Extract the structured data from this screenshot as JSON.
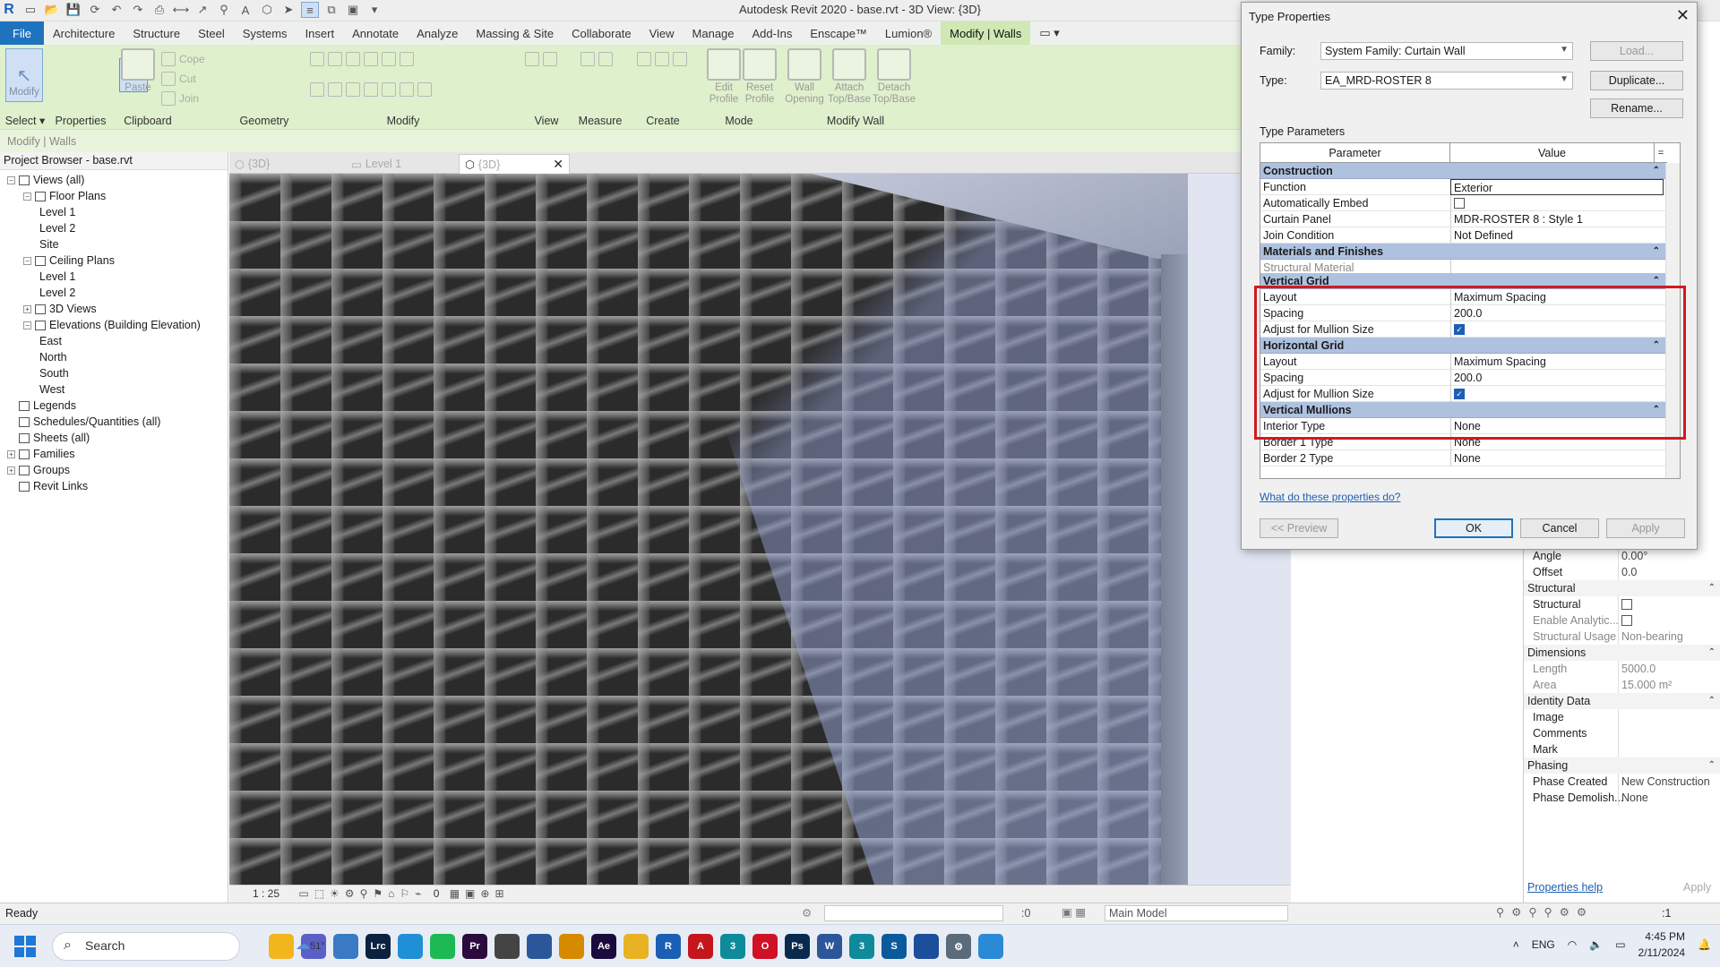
{
  "window": {
    "title": "Autodesk Revit 2020 - base.rvt - 3D View: {3D}"
  },
  "ribbon": {
    "tabs": [
      "File",
      "Architecture",
      "Structure",
      "Steel",
      "Systems",
      "Insert",
      "Annotate",
      "Analyze",
      "Massing & Site",
      "Collaborate",
      "View",
      "Manage",
      "Add-Ins",
      "Enscape™",
      "Lumion®",
      "Modify | Walls"
    ],
    "buttons": {
      "modify": "Modify",
      "paste": "Paste",
      "cope": "Cope",
      "cut": "Cut",
      "join": "Join",
      "edit_profile": "Edit Profile",
      "reset_profile": "Reset Profile",
      "wall_opening": "Wall Opening",
      "attach": "Attach Top/Base",
      "detach": "Detach Top/Base"
    },
    "groups": {
      "select": "Select",
      "properties": "Properties",
      "clipboard": "Clipboard",
      "geometry": "Geometry",
      "modify": "Modify",
      "view": "View",
      "measure": "Measure",
      "create": "Create",
      "mode": "Mode",
      "modify_wall": "Modify Wall"
    }
  },
  "option_bar": {
    "text": "Modify | Walls"
  },
  "project_browser": {
    "title": "Project Browser - base.rvt",
    "items": [
      {
        "label": "Views (all)",
        "level": 0,
        "tog": "−"
      },
      {
        "label": "Floor Plans",
        "level": 1,
        "tog": "−"
      },
      {
        "label": "Level 1",
        "level": 2
      },
      {
        "label": "Level 2",
        "level": 2
      },
      {
        "label": "Site",
        "level": 2
      },
      {
        "label": "Ceiling Plans",
        "level": 1,
        "tog": "−"
      },
      {
        "label": "Level 1",
        "level": 2
      },
      {
        "label": "Level 2",
        "level": 2
      },
      {
        "label": "3D Views",
        "level": 1,
        "tog": "+"
      },
      {
        "label": "Elevations (Building Elevation)",
        "level": 1,
        "tog": "−"
      },
      {
        "label": "East",
        "level": 2
      },
      {
        "label": "North",
        "level": 2
      },
      {
        "label": "South",
        "level": 2
      },
      {
        "label": "West",
        "level": 2
      },
      {
        "label": "Legends",
        "level": 0
      },
      {
        "label": "Schedules/Quantities (all)",
        "level": 0
      },
      {
        "label": "Sheets (all)",
        "level": 0
      },
      {
        "label": "Families",
        "level": 0,
        "tog": "+"
      },
      {
        "label": "Groups",
        "level": 0,
        "tog": "+"
      },
      {
        "label": "Revit Links",
        "level": 0
      }
    ]
  },
  "view_tabs": [
    "{3D}",
    "Level 1",
    "{3D}"
  ],
  "view_control": {
    "scale": "1 : 25",
    "zero": "0"
  },
  "status": {
    "text": "Ready",
    "model": "Main Model",
    "zero": ":0",
    "filter": ":1"
  },
  "properties": {
    "rows": [
      {
        "k": "Angle",
        "v": "0.00°"
      },
      {
        "k": "Offset",
        "v": "0.0"
      },
      {
        "k": "Structural",
        "hdr": true
      },
      {
        "k": "Structural",
        "v": "",
        "cb": true
      },
      {
        "k": "Enable Analytic...",
        "v": "",
        "cb": true,
        "dim": true
      },
      {
        "k": "Structural Usage",
        "v": "Non-bearing",
        "dim": true
      },
      {
        "k": "Dimensions",
        "hdr": true
      },
      {
        "k": "Length",
        "v": "5000.0",
        "dim": true
      },
      {
        "k": "Area",
        "v": "15.000 m²",
        "dim": true
      },
      {
        "k": "Identity Data",
        "hdr": true
      },
      {
        "k": "Image",
        "v": ""
      },
      {
        "k": "Comments",
        "v": ""
      },
      {
        "k": "Mark",
        "v": ""
      },
      {
        "k": "Phasing",
        "hdr": true
      },
      {
        "k": "Phase Created",
        "v": "New Construction"
      },
      {
        "k": "Phase Demolish...",
        "v": "None"
      }
    ],
    "help": "Properties help",
    "apply": "Apply"
  },
  "dialog": {
    "title": "Type Properties",
    "family_label": "Family:",
    "family_value": "System Family: Curtain Wall",
    "type_label": "Type:",
    "type_value": "EA_MRD-ROSTER 8",
    "load": "Load...",
    "duplicate": "Duplicate...",
    "rename": "Rename...",
    "type_params": "Type Parameters",
    "col_param": "Parameter",
    "col_value": "Value",
    "col_eq": "=",
    "rows": [
      {
        "k": "Construction",
        "hdr": true
      },
      {
        "k": "Function",
        "v": "Exterior",
        "edit": true
      },
      {
        "k": "Automatically Embed",
        "cb": false
      },
      {
        "k": "Curtain Panel",
        "v": "MDR-ROSTER 8 : Style 1"
      },
      {
        "k": "Join Condition",
        "v": "Not Defined"
      },
      {
        "k": "Materials and Finishes",
        "hdr": true
      },
      {
        "k": "Structural Material",
        "v": "",
        "dim": true
      },
      {
        "k": "Vertical Grid",
        "hdr": true
      },
      {
        "k": "Layout",
        "v": "Maximum Spacing"
      },
      {
        "k": "Spacing",
        "v": "200.0"
      },
      {
        "k": "Adjust for Mullion Size",
        "cb": true
      },
      {
        "k": "Horizontal Grid",
        "hdr": true
      },
      {
        "k": "Layout",
        "v": "Maximum Spacing"
      },
      {
        "k": "Spacing",
        "v": "200.0"
      },
      {
        "k": "Adjust for Mullion Size",
        "cb": true
      },
      {
        "k": "Vertical Mullions",
        "hdr": true
      },
      {
        "k": "Interior Type",
        "v": "None"
      },
      {
        "k": "Border 1 Type",
        "v": "None"
      },
      {
        "k": "Border 2 Type",
        "v": "None"
      }
    ],
    "what_link": "What do these properties do?",
    "preview": "<< Preview",
    "ok": "OK",
    "cancel": "Cancel",
    "apply": "Apply"
  },
  "taskbar": {
    "search": "Search",
    "weather": "51°",
    "lang": "ENG",
    "time": "4:45 PM",
    "date": "2/11/2024",
    "apps": [
      {
        "name": "file-explorer-icon",
        "color": "#f2b51c",
        "t": ""
      },
      {
        "name": "teams-icon",
        "color": "#5b5fc7",
        "t": ""
      },
      {
        "name": "photos-icon",
        "color": "#3a79c4",
        "t": ""
      },
      {
        "name": "lightroom-icon",
        "color": "#0b2140",
        "t": "Lrc"
      },
      {
        "name": "edge-icon",
        "color": "#1f8fd6",
        "t": ""
      },
      {
        "name": "spotify-icon",
        "color": "#1db954",
        "t": ""
      },
      {
        "name": "premiere-icon",
        "color": "#2b0a3d",
        "t": "Pr"
      },
      {
        "name": "globe-app-icon",
        "color": "#444",
        "t": ""
      },
      {
        "name": "calculator-app-icon",
        "color": "#2b579a",
        "t": ""
      },
      {
        "name": "media-player-icon",
        "color": "#d68a00",
        "t": ""
      },
      {
        "name": "after-effects-icon",
        "color": "#1a0b3d",
        "t": "Ae"
      },
      {
        "name": "folder-icon",
        "color": "#e8b323",
        "t": ""
      },
      {
        "name": "revit-icon",
        "color": "#1a5fb4",
        "t": "R"
      },
      {
        "name": "autocad-icon",
        "color": "#c4161c",
        "t": "A"
      },
      {
        "name": "3dsmax-icon",
        "color": "#0f8a9b",
        "t": "3"
      },
      {
        "name": "opera-icon",
        "color": "#d01025",
        "t": "O"
      },
      {
        "name": "photoshop-icon",
        "color": "#0a2a4d",
        "t": "Ps"
      },
      {
        "name": "word-icon",
        "color": "#2b579a",
        "t": "W"
      },
      {
        "name": "3dsmax2-icon",
        "color": "#0f8a9b",
        "t": "3"
      },
      {
        "name": "sketchup-icon",
        "color": "#0a5a9c",
        "t": "S"
      },
      {
        "name": "lumion-icon",
        "color": "#1b4e9b",
        "t": ""
      },
      {
        "name": "settings-icon",
        "color": "#5a6b7b",
        "t": "⚙"
      },
      {
        "name": "network-app-icon",
        "color": "#2a8ad6",
        "t": ""
      }
    ]
  }
}
